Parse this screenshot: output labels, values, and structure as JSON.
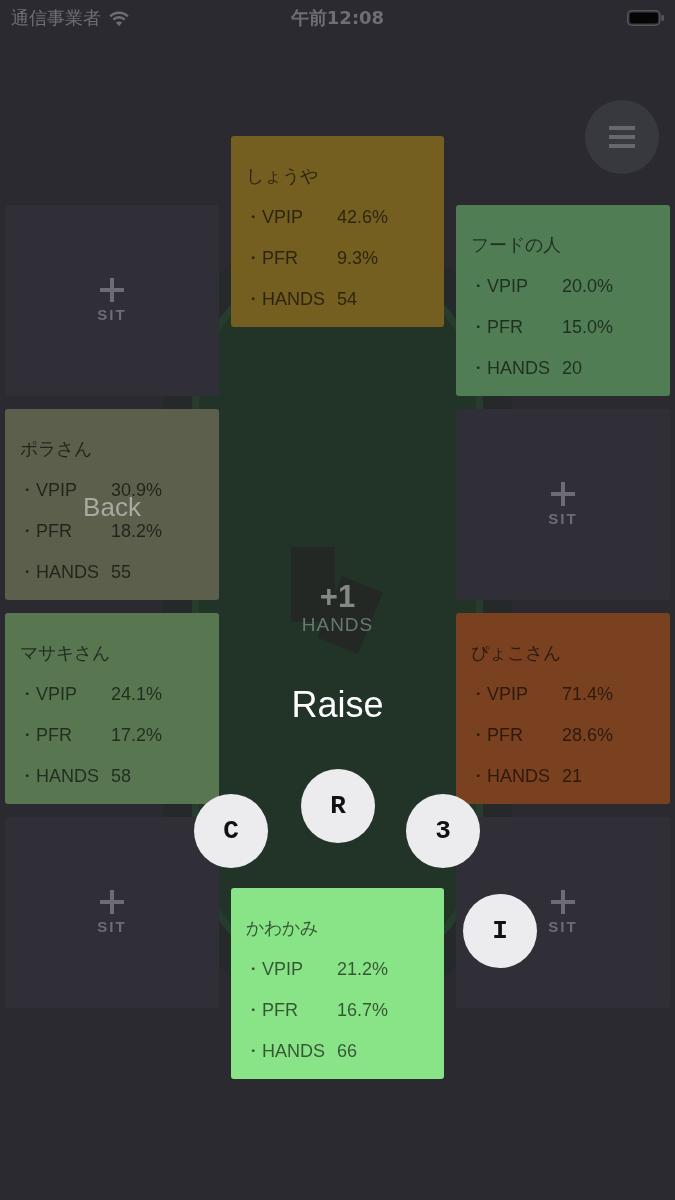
{
  "status_bar": {
    "carrier": "通信事業者",
    "time": "午前12:08"
  },
  "table": {
    "left_seats": [
      {
        "kind": "empty",
        "label": "SIT"
      },
      {
        "kind": "player",
        "name": "ポラさん",
        "color": "#5b5f4b",
        "stats": [
          {
            "label": "・VPIP",
            "value": "30.9%"
          },
          {
            "label": "・PFR",
            "value": "18.2%"
          },
          {
            "label": "・HANDS",
            "value": "55"
          }
        ],
        "overlay_label": "Back"
      },
      {
        "kind": "player",
        "name": "マサキさん",
        "color": "#587650",
        "stats": [
          {
            "label": "・VPIP",
            "value": "24.1%"
          },
          {
            "label": "・PFR",
            "value": "17.2%"
          },
          {
            "label": "・HANDS",
            "value": "58"
          }
        ]
      },
      {
        "kind": "empty",
        "label": "SIT"
      }
    ],
    "top_seat": {
      "kind": "player",
      "name": "しょうや",
      "color": "#745e20",
      "stats": [
        {
          "label": "・VPIP",
          "value": "42.6%"
        },
        {
          "label": "・PFR",
          "value": "9.3%"
        },
        {
          "label": "・HANDS",
          "value": "54"
        }
      ]
    },
    "center": {
      "count": "+1",
      "count_label": "HANDS",
      "action": "Raise"
    },
    "bottom_seat": {
      "kind": "player",
      "name": "かわかみ",
      "color": "#89e387",
      "stats": [
        {
          "label": "・VPIP",
          "value": "21.2%"
        },
        {
          "label": "・PFR",
          "value": "16.7%"
        },
        {
          "label": "・HANDS",
          "value": "66"
        }
      ]
    },
    "right_seats": [
      {
        "kind": "player",
        "name": "フードの人",
        "color": "#517d55",
        "stats": [
          {
            "label": "・VPIP",
            "value": "20.0%"
          },
          {
            "label": "・PFR",
            "value": "15.0%"
          },
          {
            "label": "・HANDS",
            "value": "20"
          }
        ]
      },
      {
        "kind": "empty",
        "label": "SIT"
      },
      {
        "kind": "player",
        "name": "ぴょこさん",
        "color": "#7a4120",
        "stats": [
          {
            "label": "・VPIP",
            "value": "71.4%"
          },
          {
            "label": "・PFR",
            "value": "28.6%"
          },
          {
            "label": "・HANDS",
            "value": "21"
          }
        ]
      },
      {
        "kind": "empty",
        "label": "SIT"
      }
    ],
    "action_buttons": [
      {
        "label": "C"
      },
      {
        "label": "R"
      },
      {
        "label": "3"
      },
      {
        "label": "I"
      }
    ]
  }
}
